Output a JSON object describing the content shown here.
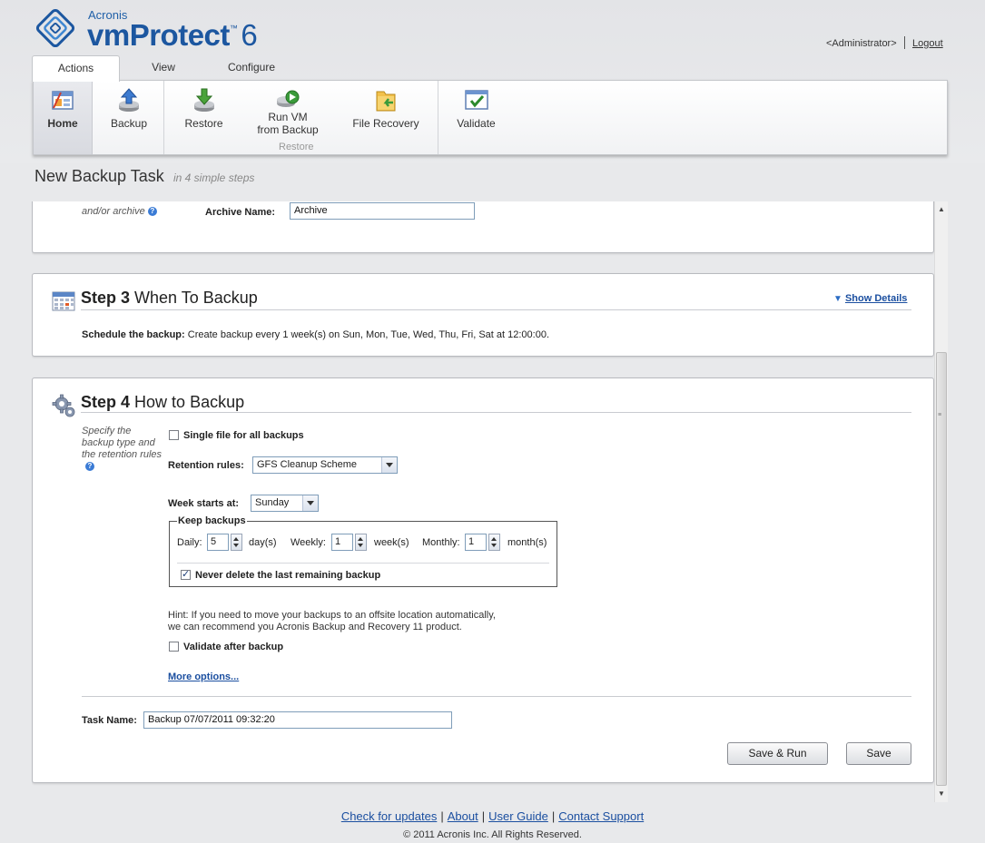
{
  "brand": {
    "company": "Acronis",
    "product": "vmProtect",
    "version": "6"
  },
  "user": {
    "name": "<Administrator>",
    "logout": "Logout"
  },
  "tabs": [
    {
      "label": "Actions",
      "active": true
    },
    {
      "label": "View"
    },
    {
      "label": "Configure"
    }
  ],
  "ribbon": {
    "home": "Home",
    "backup": "Backup",
    "restore": "Restore",
    "run_vm_line1": "Run VM",
    "run_vm_line2": "from Backup",
    "file_recovery": "File Recovery",
    "restore_group": "Restore",
    "validate": "Validate"
  },
  "page": {
    "title": "New Backup Task",
    "subtitle": "in 4 simple steps"
  },
  "step2": {
    "hint": "and/or archive",
    "archive_label": "Archive Name:",
    "archive_value": "Archive"
  },
  "step3": {
    "number": "Step 3",
    "title": "When To Backup",
    "show_details": "Show Details",
    "schedule_label": "Schedule the backup:",
    "schedule_value": "Create backup every 1 week(s) on Sun, Mon, Tue, Wed, Thu, Fri, Sat at 12:00:00."
  },
  "step4": {
    "number": "Step 4",
    "title": "How to Backup",
    "hint_line1": "Specify the",
    "hint_line2": "backup type and",
    "hint_line3": "the retention rules",
    "single_file_label": "Single file for all backups",
    "single_file_checked": false,
    "retention_label": "Retention rules:",
    "retention_value": "GFS Cleanup Scheme",
    "week_starts_label": "Week starts at:",
    "week_starts_value": "Sunday",
    "keep_backups_legend": "Keep backups",
    "daily_label": "Daily:",
    "daily_value": "5",
    "daily_unit": "day(s)",
    "weekly_label": "Weekly:",
    "weekly_value": "1",
    "weekly_unit": "week(s)",
    "monthly_label": "Monthly:",
    "monthly_value": "1",
    "monthly_unit": "month(s)",
    "never_delete_label": "Never delete the last remaining backup",
    "never_delete_checked": true,
    "hint_text_line1": "Hint: If you need to move your backups to an offsite location automatically,",
    "hint_text_line2": "we can recommend you Acronis Backup and Recovery 11 product.",
    "validate_label": "Validate after backup",
    "validate_checked": false,
    "more_options": "More options...",
    "task_name_label": "Task Name:",
    "task_name_value": "Backup 07/07/2011 09:32:20",
    "save_run": "Save & Run",
    "save": "Save"
  },
  "footer": {
    "links": [
      "Check for updates",
      "About",
      "User Guide",
      "Contact Support"
    ],
    "separator": "|",
    "copyright": "© 2011 Acronis Inc. All Rights Reserved."
  },
  "colors": {
    "brand_blue": "#1c57a0",
    "link_blue": "#1b4fa0",
    "background": "#e8e9eb"
  }
}
